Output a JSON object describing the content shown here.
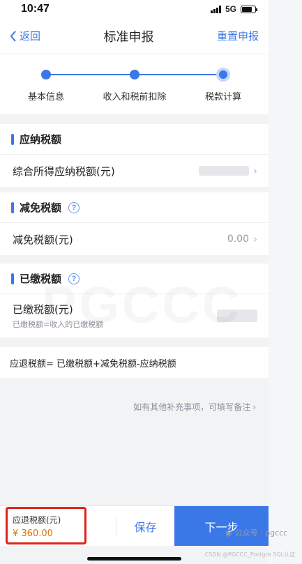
{
  "status_bar": {
    "time": "10:47",
    "network": "5G"
  },
  "nav": {
    "back_label": "返回",
    "title": "标准申报",
    "reset_label": "重置申报"
  },
  "steps": [
    {
      "label": "基本信息"
    },
    {
      "label": "收入和税前扣除"
    },
    {
      "label": "税款计算"
    }
  ],
  "sections": {
    "payable": {
      "title": "应纳税额",
      "row_label": "综合所得应纳税额(元)"
    },
    "exemption": {
      "title": "减免税额",
      "row_label": "减免税额(元)",
      "row_value": "0.00"
    },
    "paid": {
      "title": "已缴税额",
      "row_label": "已缴税额(元)",
      "row_sub": "已缴税额=收入的已缴税额"
    }
  },
  "formula": "应退税额= 已缴税额+减免税额-应纳税额",
  "note": "如有其他补充事项，可填写备注",
  "bottom": {
    "refund_label": "应退税额(元)",
    "refund_amount": "¥ 360.00",
    "save_label": "保存",
    "next_label": "下一步"
  },
  "watermark": {
    "big": "PGCCC",
    "mp": "公众号 · pgccc",
    "csdn": "CSDN @PGCCC_Postgre SQL认证"
  },
  "colors": {
    "accent": "#3b78e7",
    "highlight_box": "#e0221b",
    "amount": "#e07300"
  }
}
